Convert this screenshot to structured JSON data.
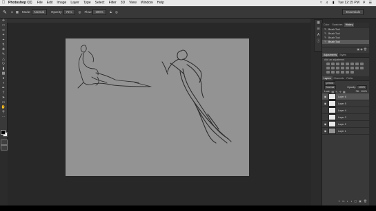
{
  "menubar": {
    "apple_icon": "apple-logo",
    "app_name": "Photoshop CC",
    "items": [
      "File",
      "Edit",
      "Image",
      "Layer",
      "Type",
      "Select",
      "Filter",
      "3D",
      "View",
      "Window",
      "Help"
    ],
    "clock": "Tue 12:15 PM"
  },
  "options_bar": {
    "mode_label": "Mode:",
    "mode_value": "Normal",
    "opacity_label": "Opacity:",
    "opacity_value": "71%",
    "flow_label": "Flow:",
    "flow_value": "100%",
    "workspace": "Essentials"
  },
  "history": {
    "tabs": [
      "Color",
      "Swatches",
      "History"
    ],
    "active_tab": "History",
    "items": [
      "Brush Tool",
      "Brush Tool",
      "Brush Tool",
      "Brush Tool"
    ]
  },
  "adjustments": {
    "tabs": [
      "Adjustments",
      "Styles"
    ],
    "add_label": "Add an adjustment"
  },
  "layers_panel": {
    "tabs": [
      "Layers",
      "Channels",
      "Paths"
    ],
    "kind_label": "ρ Kind",
    "blend_mode": "Normal",
    "opacity_label": "Opacity:",
    "opacity_value": "100%",
    "lock_label": "Lock:",
    "fill_label": "Fill:",
    "fill_value": "100%",
    "layers": [
      "Layer 6",
      "Layer 5",
      "Layer 4",
      "Layer 3",
      "Layer 2",
      "Layer 1"
    ],
    "selected_layer": "Layer 6"
  },
  "colors": {
    "foreground": "#000000",
    "background": "#ffffff",
    "canvas": "#939393"
  }
}
